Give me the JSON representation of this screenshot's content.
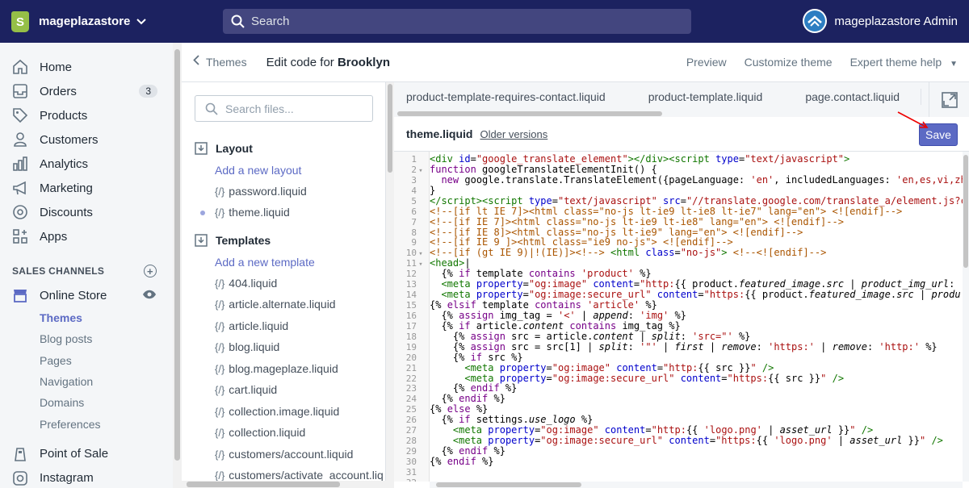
{
  "topbar": {
    "store_name": "mageplazastore",
    "search_placeholder": "Search",
    "user_name": "mageplazastore Admin"
  },
  "nav": {
    "items": [
      {
        "label": "Home",
        "icon": "home-icon"
      },
      {
        "label": "Orders",
        "icon": "orders-icon",
        "badge": "3"
      },
      {
        "label": "Products",
        "icon": "tag-icon"
      },
      {
        "label": "Customers",
        "icon": "person-icon"
      },
      {
        "label": "Analytics",
        "icon": "bar-chart-icon"
      },
      {
        "label": "Marketing",
        "icon": "megaphone-icon"
      },
      {
        "label": "Discounts",
        "icon": "discount-icon"
      },
      {
        "label": "Apps",
        "icon": "apps-icon"
      }
    ],
    "sales_channels_label": "SALES CHANNELS",
    "online_store_label": "Online Store",
    "online_store_sub": [
      "Themes",
      "Blog posts",
      "Pages",
      "Navigation",
      "Domains",
      "Preferences"
    ],
    "point_of_sale_label": "Point of Sale",
    "instagram_label": "Instagram"
  },
  "header": {
    "back_label": "Themes",
    "title_prefix": "Edit code for",
    "theme_name": "Brooklyn",
    "preview": "Preview",
    "customize": "Customize theme",
    "expert_help": "Expert theme help"
  },
  "files": {
    "search_placeholder": "Search files...",
    "layout_label": "Layout",
    "add_layout": "Add a new layout",
    "layout_files": [
      "password.liquid",
      "theme.liquid"
    ],
    "templates_label": "Templates",
    "add_template": "Add a new template",
    "template_files": [
      "404.liquid",
      "article.alternate.liquid",
      "article.liquid",
      "blog.liquid",
      "blog.mageplaze.liquid",
      "cart.liquid",
      "collection.image.liquid",
      "collection.liquid",
      "customers/account.liquid",
      "customers/activate_account.liq"
    ]
  },
  "editor": {
    "tabs": [
      "product-template-requires-contact.liquid",
      "product-template.liquid",
      "page.contact.liquid"
    ],
    "file_name": "theme.liquid",
    "older_versions": "Older versions",
    "save_label": "Save"
  }
}
